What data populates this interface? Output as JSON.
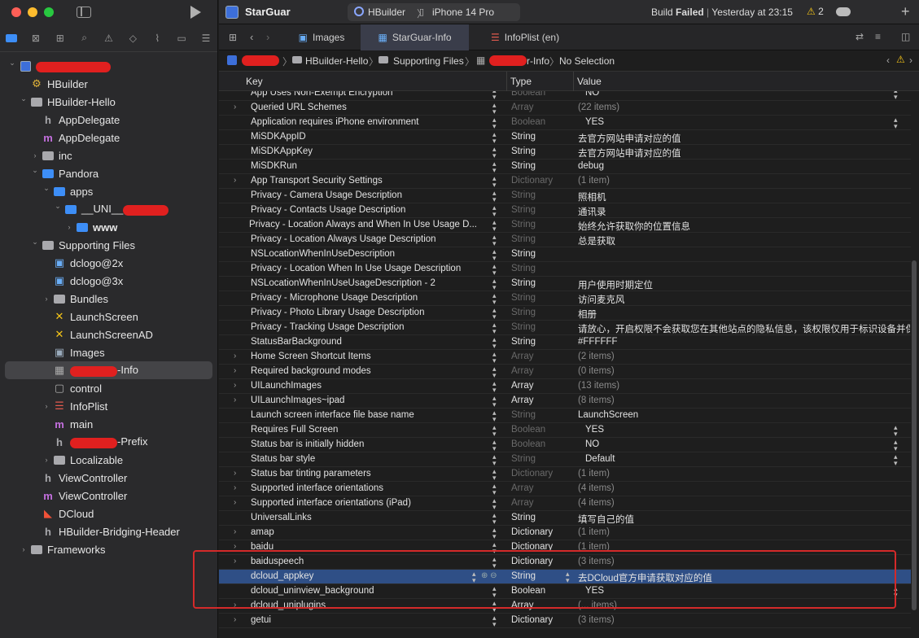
{
  "app": {
    "name": "StarGuar"
  },
  "toolbar": {
    "scheme": "HBuilder",
    "device": "iPhone 14 Pro",
    "status_prefix": "Build ",
    "status_bold": "Failed",
    "status_time": "Yesterday at 23:15",
    "warnings": "2"
  },
  "tabs": [
    {
      "label": "Images"
    },
    {
      "label": "StarGuar-Info"
    },
    {
      "label": "InfoPlist (en)"
    }
  ],
  "breadcrumb": {
    "proj": "HBuilder-Hello",
    "folder": "Supporting Files",
    "file_suffix": "r-Info",
    "selection": "No Selection"
  },
  "columns": {
    "key": "Key",
    "type": "Type",
    "value": "Value"
  },
  "sidebar": {
    "items": [
      {
        "label": "",
        "redacted": true
      },
      {
        "label": "HBuilder"
      },
      {
        "label": "HBuilder-Hello"
      },
      {
        "label": "AppDelegate"
      },
      {
        "label": "AppDelegate"
      },
      {
        "label": "inc"
      },
      {
        "label": "Pandora"
      },
      {
        "label": "apps"
      },
      {
        "label": "__UNI__"
      },
      {
        "label": "www"
      },
      {
        "label": "Supporting Files"
      },
      {
        "label": "dclogo@2x"
      },
      {
        "label": "dclogo@3x"
      },
      {
        "label": "Bundles"
      },
      {
        "label": "LaunchScreen"
      },
      {
        "label": "LaunchScreenAD"
      },
      {
        "label": "Images"
      },
      {
        "label": "-Info"
      },
      {
        "label": "control"
      },
      {
        "label": "InfoPlist"
      },
      {
        "label": "main"
      },
      {
        "label": "-Prefix"
      },
      {
        "label": "Localizable"
      },
      {
        "label": "ViewController"
      },
      {
        "label": "ViewController"
      },
      {
        "label": "DCloud"
      },
      {
        "label": "HBuilder-Bridging-Header"
      },
      {
        "label": "Frameworks"
      }
    ]
  },
  "plist": [
    {
      "key": "App Uses Non-Exempt Encryption",
      "type": "Boolean",
      "value": "NO"
    },
    {
      "key": "Queried URL Schemes",
      "type": "Array",
      "value": "(22 items)"
    },
    {
      "key": "Application requires iPhone environment",
      "type": "Boolean",
      "value": "YES"
    },
    {
      "key": "MiSDKAppID",
      "type": "String",
      "value": "去官方网站申请对应的值"
    },
    {
      "key": "MiSDKAppKey",
      "type": "String",
      "value": "去官方网站申请对应的值"
    },
    {
      "key": "MiSDKRun",
      "type": "String",
      "value": "debug"
    },
    {
      "key": "App Transport Security Settings",
      "type": "Dictionary",
      "value": "(1 item)"
    },
    {
      "key": "Privacy - Camera Usage Description",
      "type": "String",
      "value": "照相机"
    },
    {
      "key": "Privacy - Contacts Usage Description",
      "type": "String",
      "value": "通讯录"
    },
    {
      "key": "Privacy - Location Always and When In Use Usage D...",
      "type": "String",
      "value": "始终允许获取你的位置信息"
    },
    {
      "key": "Privacy - Location Always Usage Description",
      "type": "String",
      "value": "总是获取"
    },
    {
      "key": "NSLocationWhenInUseDescription",
      "type": "String",
      "value": ""
    },
    {
      "key": "Privacy - Location When In Use Usage Description",
      "type": "String",
      "value": ""
    },
    {
      "key": "NSLocationWhenInUseUsageDescription - 2",
      "type": "String",
      "value": "用户使用时期定位"
    },
    {
      "key": "Privacy - Microphone Usage Description",
      "type": "String",
      "value": "访问麦克风"
    },
    {
      "key": "Privacy - Photo Library Usage Description",
      "type": "String",
      "value": "相册"
    },
    {
      "key": "Privacy - Tracking Usage Description",
      "type": "String",
      "value": "请放心，开启权限不会获取您在其他站点的隐私信息，该权限仅用于标识设备并保"
    },
    {
      "key": "StatusBarBackground",
      "type": "String",
      "value": "#FFFFFF"
    },
    {
      "key": "Home Screen Shortcut Items",
      "type": "Array",
      "value": "(2 items)"
    },
    {
      "key": "Required background modes",
      "type": "Array",
      "value": "(0 items)"
    },
    {
      "key": "UILaunchImages",
      "type": "Array",
      "value": "(13 items)"
    },
    {
      "key": "UILaunchImages~ipad",
      "type": "Array",
      "value": "(8 items)"
    },
    {
      "key": "Launch screen interface file base name",
      "type": "String",
      "value": "LaunchScreen"
    },
    {
      "key": "Requires Full Screen",
      "type": "Boolean",
      "value": "YES"
    },
    {
      "key": "Status bar is initially hidden",
      "type": "Boolean",
      "value": "NO"
    },
    {
      "key": "Status bar style",
      "type": "String",
      "value": "Default"
    },
    {
      "key": "Status bar tinting parameters",
      "type": "Dictionary",
      "value": "(1 item)"
    },
    {
      "key": "Supported interface orientations",
      "type": "Array",
      "value": "(4 items)"
    },
    {
      "key": "Supported interface orientations (iPad)",
      "type": "Array",
      "value": "(4 items)"
    },
    {
      "key": "UniversalLinks",
      "type": "String",
      "value": "填写自己的值"
    },
    {
      "key": "amap",
      "type": "Dictionary",
      "value": "(1 item)"
    },
    {
      "key": "baidu",
      "type": "Dictionary",
      "value": "(1 item)"
    },
    {
      "key": "baiduspeech",
      "type": "Dictionary",
      "value": "(3 items)"
    },
    {
      "key": "dcloud_appkey",
      "type": "String",
      "value": "去DCloud官方申请获取对应的值"
    },
    {
      "key": "dcloud_uninview_background",
      "type": "Boolean",
      "value": "YES"
    },
    {
      "key": "dcloud_uniplugins",
      "type": "Array",
      "value": "(... items)"
    },
    {
      "key": "getui",
      "type": "Dictionary",
      "value": "(3 items)"
    }
  ],
  "colors": {
    "accent": "#3d8ef7",
    "annotation": "#d42a2a",
    "selected_row": "#2f4f86"
  }
}
